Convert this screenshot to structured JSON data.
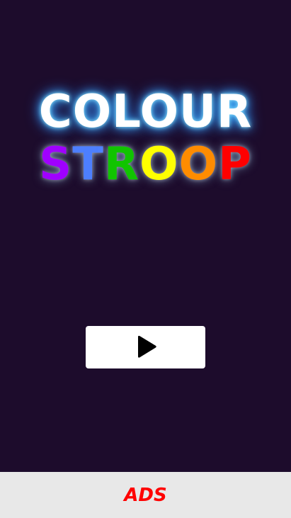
{
  "game": {
    "title_line1": "COLOUR",
    "title_line2_letters": [
      {
        "char": "S",
        "color": "#a000ff"
      },
      {
        "char": "T",
        "color": "#4d7fff"
      },
      {
        "char": "R",
        "color": "#11c400"
      },
      {
        "char": "O",
        "color": "#ffff00"
      },
      {
        "char": "O",
        "color": "#ff8c00"
      },
      {
        "char": "P",
        "color": "#ff0000"
      }
    ],
    "title_glow_color": "#3fb7ff",
    "background_color": "#1d0c2c"
  },
  "play_button": {
    "icon": "play-icon",
    "background_color": "#ffffff",
    "icon_color": "#000000"
  },
  "ads_bar": {
    "label": "ADS",
    "label_color": "#ff0000",
    "background_color": "#e8e8e8"
  }
}
